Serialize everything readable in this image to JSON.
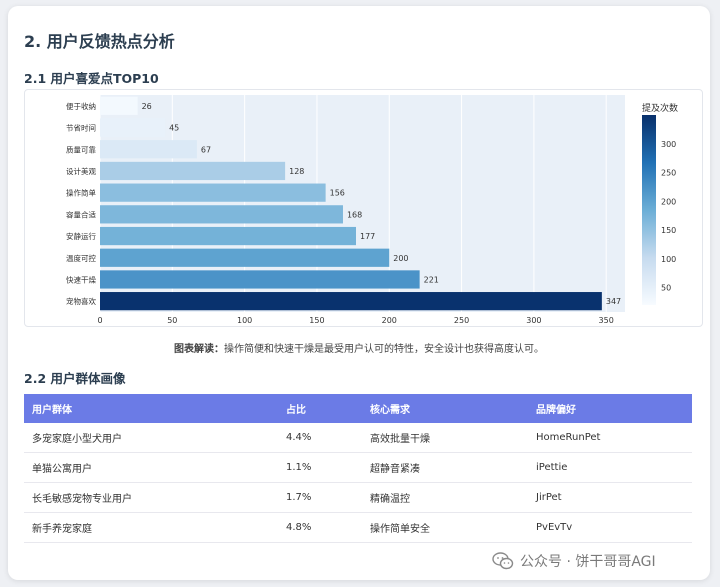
{
  "section_title": "2. 用户反馈热点分析",
  "sub1_title": "2.1 用户喜爱点TOP10",
  "chart_data": {
    "type": "bar",
    "orientation": "horizontal",
    "categories": [
      "便于收纳",
      "节省时间",
      "质量可靠",
      "设计美观",
      "操作简单",
      "容量合适",
      "安静运行",
      "温度可控",
      "快速干燥",
      "宠物喜欢"
    ],
    "values": [
      26,
      45,
      67,
      128,
      156,
      168,
      177,
      200,
      221,
      347
    ],
    "xlim": [
      0,
      363
    ],
    "xticks": [
      0,
      50,
      100,
      150,
      200,
      250,
      300,
      350
    ],
    "colorbar_title": "提及次数",
    "colorbar_ticks": [
      50,
      100,
      150,
      200,
      250,
      300
    ],
    "colorscale": [
      "#f7fbff",
      "#c6dbef",
      "#6baed6",
      "#2171b5",
      "#08306b"
    ],
    "grid": true
  },
  "caption": {
    "label": "图表解读：",
    "text": "操作简便和快速干燥是最受用户认可的特性，安全设计也获得高度认可。"
  },
  "sub2_title": "2.2 用户群体画像",
  "table": {
    "headers": [
      "用户群体",
      "占比",
      "核心需求",
      "品牌偏好"
    ],
    "rows": [
      [
        "多宠家庭小型犬用户",
        "4.4%",
        "高效批量干燥",
        "HomeRunPet"
      ],
      [
        "单猫公寓用户",
        "1.1%",
        "超静音紧凑",
        "iPettie"
      ],
      [
        "长毛敏感宠物专业用户",
        "1.7%",
        "精确温控",
        "JirPet"
      ],
      [
        "新手养宠家庭",
        "4.8%",
        "操作简单安全",
        "PvEvTv"
      ]
    ]
  },
  "watermark": "公众号 · 饼干哥哥AGI"
}
